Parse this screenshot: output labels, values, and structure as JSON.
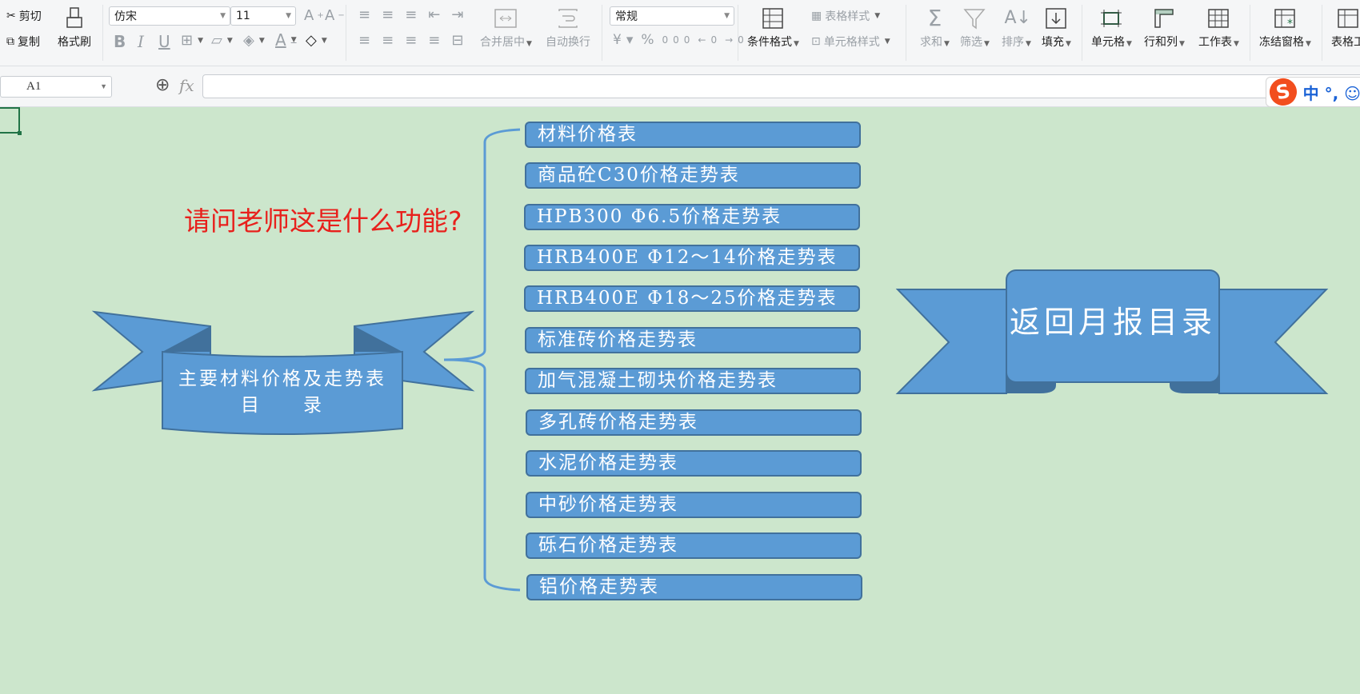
{
  "toolbar": {
    "cut": "剪切",
    "copy": "复制",
    "format_painter": "格式刷",
    "font_name": "仿宋",
    "font_size": "11",
    "merge_center": "合并居中",
    "auto_wrap": "自动换行",
    "number_format": "常规",
    "conditional_format": "条件格式",
    "table_style": "表格样式",
    "cell_style": "单元格样式",
    "sum": "求和",
    "filter": "筛选",
    "sort": "排序",
    "fill": "填充",
    "cell": "单元格",
    "row_col": "行和列",
    "worksheet": "工作表",
    "freeze": "冻结窗格",
    "table_tools": "表格工"
  },
  "formula_bar": {
    "cell_ref": "A1",
    "fx_label": "fx",
    "value": ""
  },
  "ime": {
    "logo": "S",
    "mode": "中 °, ☺"
  },
  "sheet": {
    "question": "请问老师这是什么功能?",
    "left_ribbon": {
      "line1": "主要材料价格及走势表",
      "line2": "目　　录"
    },
    "right_ribbon": {
      "label": "返回月报目录"
    },
    "items": [
      "材料价格表",
      "商品砼C30价格走势表",
      "HPB300 Φ6.5价格走势表",
      "HRB400E Φ12～14价格走势表",
      "HRB400E Φ18～25价格走势表",
      "标准砖价格走势表",
      "加气混凝土砌块价格走势表",
      "多孔砖价格走势表",
      "水泥价格走势表",
      "中砂价格走势表",
      "砾石价格走势表",
      "铝价格走势表"
    ]
  },
  "colors": {
    "sheet_bg": "#cce6cc",
    "shape_fill": "#5b9bd5",
    "shape_border": "#41719c",
    "question_text": "#e8201c",
    "bracket": "#5b9bd5"
  }
}
